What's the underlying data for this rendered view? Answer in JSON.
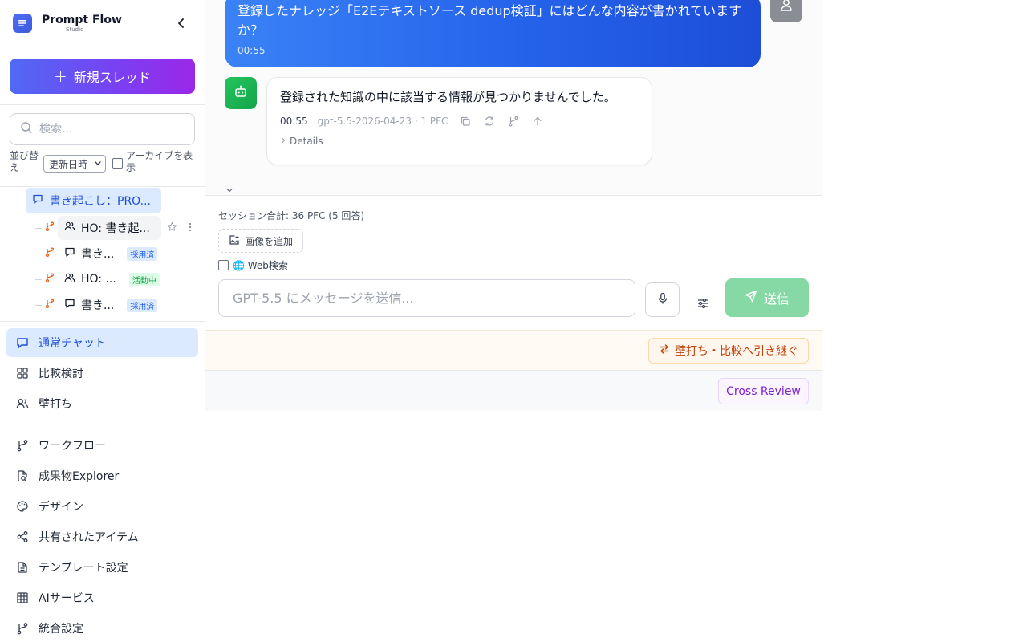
{
  "brand": {
    "title": "Prompt Flow",
    "subtitle": "Studio"
  },
  "sidebar": {
    "new_thread_label": "新規スレッド",
    "search_placeholder": "検索...",
    "sort_label": "並び替え",
    "sort_value": "更新日時",
    "archive_label": "アーカイブを表示",
    "thread_parent": "書き起こし：PRO...",
    "children": [
      {
        "label": "HO: 書き起...",
        "icon": "users-icon",
        "badge": ""
      },
      {
        "label": "書き...",
        "icon": "chat-icon",
        "badge": "採用済"
      },
      {
        "label": "HO: ...",
        "icon": "users-icon",
        "badge": "活動中"
      },
      {
        "label": "書き...",
        "icon": "chat-icon",
        "badge": "採用済"
      }
    ],
    "nav_primary": [
      {
        "label": "通常チャット",
        "icon": "chat-icon"
      },
      {
        "label": "比較検討",
        "icon": "grid-icon"
      },
      {
        "label": "壁打ち",
        "icon": "users-icon"
      }
    ],
    "nav_secondary": [
      {
        "label": "ワークフロー",
        "icon": "branch-icon"
      },
      {
        "label": "成果物Explorer",
        "icon": "file-search-icon"
      },
      {
        "label": "デザイン",
        "icon": "palette-icon"
      },
      {
        "label": "共有されたアイテム",
        "icon": "share-icon"
      },
      {
        "label": "テンプレート設定",
        "icon": "document-icon"
      },
      {
        "label": "AIサービス",
        "icon": "table-icon"
      },
      {
        "label": "統合設定",
        "icon": "branch-icon"
      }
    ]
  },
  "chat": {
    "user_message": "登録したナレッジ「E2Eテキストソース dedup検証」にはどんな内容が書かれていますか？",
    "user_time": "00:55",
    "bot_message": "登録された知識の中に該当する情報が見つかりませんでした。",
    "bot_time": "00:55",
    "bot_meta": "gpt-5.5-2026-04-23 · 1 PFC",
    "details_label": "Details"
  },
  "composer": {
    "session_total": "セッション合計: 36 PFC (5 回答)",
    "add_image_label": "画像を追加",
    "web_search_label": "🌐 Web検索",
    "input_placeholder": "GPT-5.5 にメッセージを送信...",
    "send_label": "送信",
    "handoff_label": "壁打ち・比較へ引き継ぐ",
    "cross_review_label": "Cross Review"
  },
  "colors": {
    "accent": "#2563eb",
    "send_disabled": "#86d9a4",
    "handoff": "#c2410c",
    "review": "#7e22ce"
  }
}
